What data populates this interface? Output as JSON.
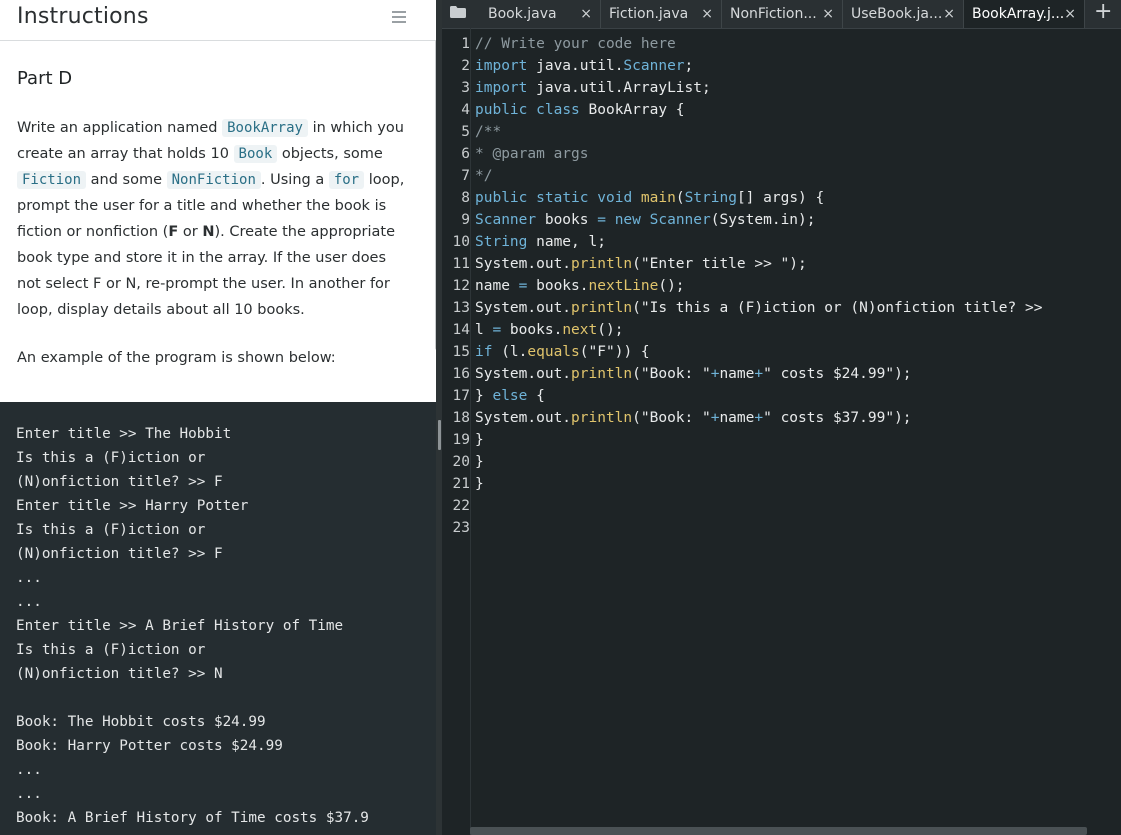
{
  "instructions": {
    "header_title": "Instructions",
    "part_title": "Part D",
    "desc": {
      "t1": "Write an application named ",
      "c1": "BookArray",
      "t2": " in which you create an array that holds 10 ",
      "c2": "Book",
      "t3": " objects, some ",
      "c3": "Fiction",
      "t4": " and some ",
      "c4": "NonFiction",
      "t5": ". Using a ",
      "c5": "for",
      "t6": " loop, prompt the user for a title and whether the book is fiction or nonfiction (",
      "b1": "F",
      "t7": " or ",
      "b2": "N",
      "t8": "). Create the appropriate book type and store it in the array. If the user does not select F or N, re-prompt the user. In another for loop, display details about all 10 books."
    },
    "example_intro": "An example of the program is shown below:",
    "example_output": [
      "Enter title >> The Hobbit",
      "Is this a (F)iction or",
      "(N)onfiction title? >> F",
      "Enter title >> Harry Potter",
      "Is this a (F)iction or",
      "(N)onfiction title? >> F",
      "...",
      "...",
      "Enter title >> A Brief History of Time",
      "Is this a (F)iction or",
      "(N)onfiction title? >> N",
      "",
      "Book: The Hobbit costs $24.99",
      "Book: Harry Potter costs $24.99",
      "...",
      "...",
      "Book: A Brief History of Time costs $37.9"
    ]
  },
  "editor": {
    "tabs": [
      {
        "label": "Book.java",
        "close": "×",
        "active": false
      },
      {
        "label": "Fiction.java",
        "close": "×",
        "active": false
      },
      {
        "label": "NonFiction...",
        "close": "×",
        "active": false
      },
      {
        "label": "UseBook.ja...",
        "close": "×",
        "active": false
      },
      {
        "label": "BookArray.j...",
        "close": "×",
        "active": true
      }
    ],
    "add_tab": "+",
    "line_numbers": [
      "1",
      "2",
      "3",
      "4",
      "5",
      "6",
      "7",
      "8",
      "9",
      "10",
      "11",
      "12",
      "13",
      "14",
      "15",
      "16",
      "17",
      "18",
      "19",
      "20",
      "21",
      "22",
      "23"
    ],
    "code_lines": [
      "// Write your code here",
      "import java.util.Scanner;",
      "import java.util.ArrayList;",
      "public class BookArray {",
      "/**",
      "* @param args",
      "*/",
      "public static void main(String[] args) {",
      "Scanner books = new Scanner(System.in);",
      "String name, l;",
      "System.out.println(\"Enter title >> \");",
      "name = books.nextLine();",
      "System.out.println(\"Is this a (F)iction or (N)onfiction title? >> ",
      "l = books.next();",
      "if (l.equals(\"F\")) {",
      "System.out.println(\"Book: \"+name+\" costs $24.99\");",
      "} else {",
      "System.out.println(\"Book: \"+name+\" costs $37.99\");",
      "}",
      "}",
      "}",
      "",
      ""
    ]
  }
}
